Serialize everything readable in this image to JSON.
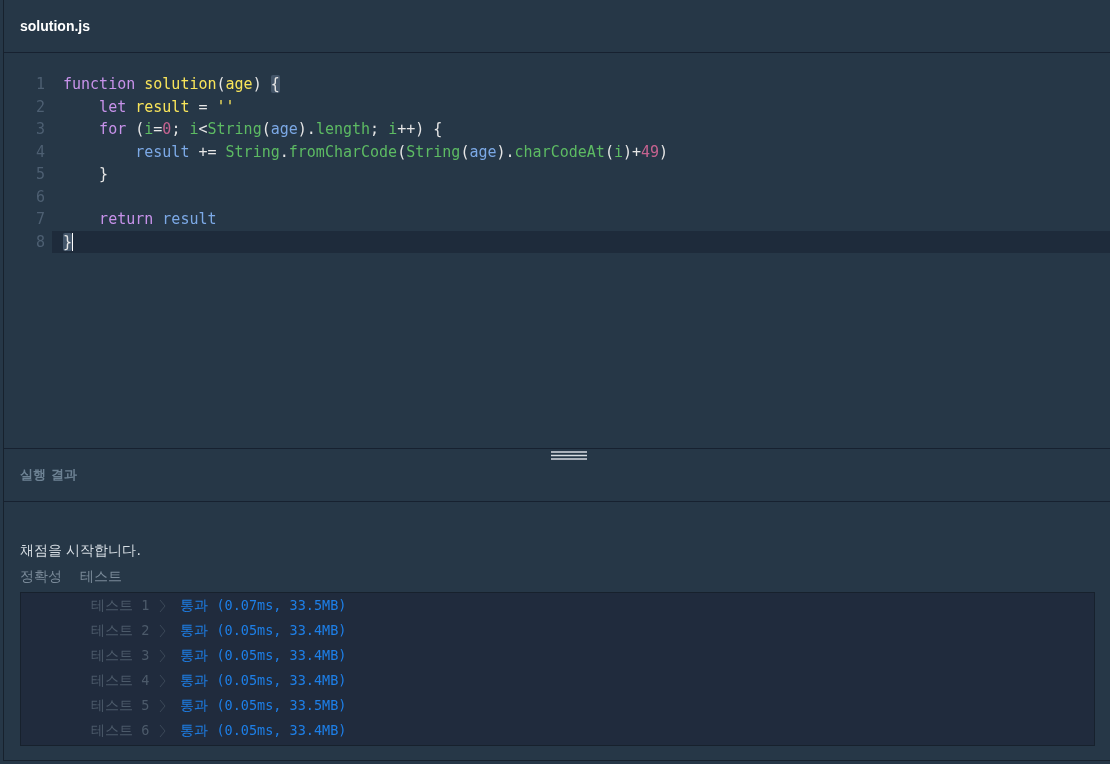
{
  "editor": {
    "title": "solution.js",
    "lines": [
      {
        "number": "1",
        "active": false,
        "tokens": [
          {
            "text": "function ",
            "kind": "keyword"
          },
          {
            "text": "solution",
            "kind": "decl"
          },
          {
            "text": "(",
            "kind": "plain"
          },
          {
            "text": "age",
            "kind": "decl"
          },
          {
            "text": ") ",
            "kind": "plain"
          },
          {
            "text": "{",
            "kind": "match"
          }
        ]
      },
      {
        "number": "2",
        "active": false,
        "tokens": [
          {
            "text": "    let ",
            "kind": "keyword"
          },
          {
            "text": "result",
            "kind": "decl"
          },
          {
            "text": " = ",
            "kind": "plain"
          },
          {
            "text": "''",
            "kind": "decl"
          }
        ]
      },
      {
        "number": "3",
        "active": false,
        "tokens": [
          {
            "text": "    for",
            "kind": "keyword"
          },
          {
            "text": " (",
            "kind": "plain"
          },
          {
            "text": "i",
            "kind": "builtin"
          },
          {
            "text": "=",
            "kind": "plain"
          },
          {
            "text": "0",
            "kind": "number"
          },
          {
            "text": "; ",
            "kind": "plain"
          },
          {
            "text": "i",
            "kind": "builtin"
          },
          {
            "text": "<",
            "kind": "plain"
          },
          {
            "text": "String",
            "kind": "builtin"
          },
          {
            "text": "(",
            "kind": "plain"
          },
          {
            "text": "age",
            "kind": "var"
          },
          {
            "text": ").",
            "kind": "plain"
          },
          {
            "text": "length",
            "kind": "builtin"
          },
          {
            "text": "; ",
            "kind": "plain"
          },
          {
            "text": "i",
            "kind": "builtin"
          },
          {
            "text": "++) {",
            "kind": "plain"
          }
        ]
      },
      {
        "number": "4",
        "active": false,
        "tokens": [
          {
            "text": "        result",
            "kind": "var"
          },
          {
            "text": " += ",
            "kind": "plain"
          },
          {
            "text": "String",
            "kind": "builtin"
          },
          {
            "text": ".",
            "kind": "plain"
          },
          {
            "text": "fromCharCode",
            "kind": "builtin"
          },
          {
            "text": "(",
            "kind": "plain"
          },
          {
            "text": "String",
            "kind": "builtin"
          },
          {
            "text": "(",
            "kind": "plain"
          },
          {
            "text": "age",
            "kind": "var"
          },
          {
            "text": ").",
            "kind": "plain"
          },
          {
            "text": "charCodeAt",
            "kind": "builtin"
          },
          {
            "text": "(",
            "kind": "plain"
          },
          {
            "text": "i",
            "kind": "builtin"
          },
          {
            "text": ")+",
            "kind": "plain"
          },
          {
            "text": "49",
            "kind": "number"
          },
          {
            "text": ")",
            "kind": "plain"
          }
        ]
      },
      {
        "number": "5",
        "active": false,
        "tokens": [
          {
            "text": "    }",
            "kind": "plain"
          }
        ]
      },
      {
        "number": "6",
        "active": false
      },
      {
        "number": "7",
        "active": false,
        "tokens": [
          {
            "text": "    return ",
            "kind": "keyword"
          },
          {
            "text": "result",
            "kind": "var"
          }
        ]
      },
      {
        "number": "8",
        "active": true,
        "tokens": [
          {
            "text": "}",
            "kind": "match"
          }
        ]
      }
    ]
  },
  "results": {
    "title": "실행 결과",
    "message": "채점을 시작합니다.",
    "group_labels": [
      "정확성",
      "테스트"
    ],
    "tests": [
      {
        "label": "테스트 1",
        "result": "통과 (0.07ms, 33.5MB)"
      },
      {
        "label": "테스트 2",
        "result": "통과 (0.05ms, 33.4MB)"
      },
      {
        "label": "테스트 3",
        "result": "통과 (0.05ms, 33.4MB)"
      },
      {
        "label": "테스트 4",
        "result": "통과 (0.05ms, 33.4MB)"
      },
      {
        "label": "테스트 5",
        "result": "통과 (0.05ms, 33.5MB)"
      },
      {
        "label": "테스트 6",
        "result": "통과 (0.05ms, 33.4MB)"
      }
    ]
  }
}
